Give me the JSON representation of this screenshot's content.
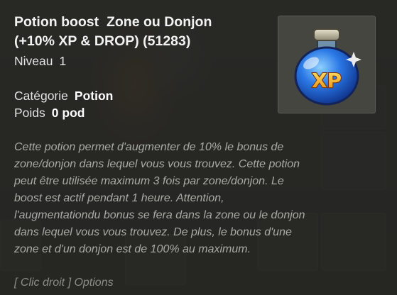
{
  "item": {
    "title": "Potion boost  Zone ou Donjon\n(+10% XP & DROP) (51283)",
    "level_label": "Niveau",
    "level_value": "1",
    "category_label": "Catégorie",
    "category_value": "Potion",
    "weight_label": "Poids",
    "weight_value": "0 pod",
    "description": "Cette potion permet d'augmenter de 10% le bonus de\nzone/donjon dans lequel vous vous trouvez. Cette potion\npeut être utilisée maximum 3 fois par zone/donjon. Le\nboost est actif pendant 1 heure. Attention,\nl'augmentationdu bonus se fera dans la zone ou le donjon\ndans lequel vous vous trouvez. De plus, le bonus d'une\nzone et d'un donjon est de 100% au maximum.",
    "icon": "xp-potion-icon",
    "icon_text": "XP"
  },
  "footer": {
    "hint": "[ Clic droit ] Options"
  },
  "colors": {
    "tooltip_bg": "#262624",
    "title_text": "#f2f2f2",
    "description_text": "#a9aaa4",
    "potion_glass": "#1f62d6",
    "xp_text": "#f2b21c"
  }
}
